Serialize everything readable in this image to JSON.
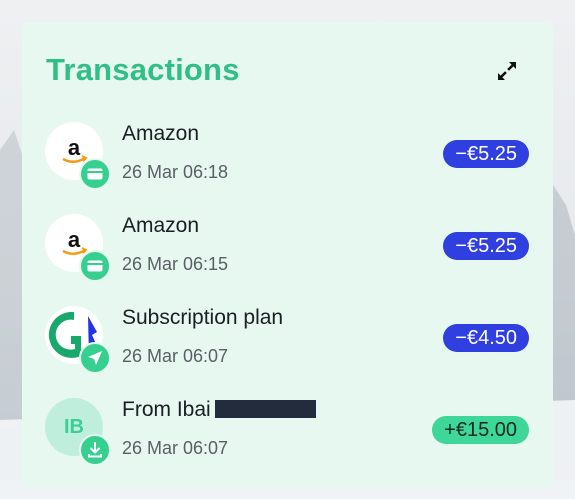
{
  "widget": {
    "title": "Transactions",
    "expand_icon": "expand-arrows-icon"
  },
  "transactions": [
    {
      "name": "Amazon",
      "date": "26 Mar 06:18",
      "amount": "−€5.25",
      "type": "debit",
      "avatar": "amazon-logo",
      "badge_icon": "card-icon"
    },
    {
      "name": "Amazon",
      "date": "26 Mar 06:15",
      "amount": "−€5.25",
      "type": "debit",
      "avatar": "amazon-logo",
      "badge_icon": "card-icon"
    },
    {
      "name": "Subscription plan",
      "date": "26 Mar 06:07",
      "amount": "−€4.50",
      "type": "debit",
      "avatar": "subscription-logo",
      "badge_icon": "send-icon"
    },
    {
      "name": "From Ibai",
      "date": "26 Mar 06:07",
      "amount": "+€15.00",
      "type": "credit",
      "avatar_initials": "IB",
      "badge_icon": "download-icon"
    }
  ],
  "colors": {
    "card_bg": "#e6f8ef",
    "title": "#2fbf87",
    "debit_pill": "#2f3fe0",
    "credit_pill": "#3fd69a",
    "badge": "#35cf90"
  }
}
